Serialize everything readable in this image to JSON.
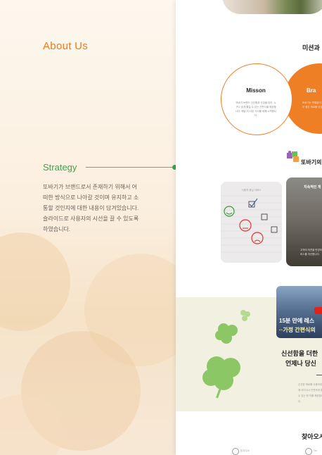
{
  "left": {
    "section_title": "About Us",
    "strategy_label": "Strategy",
    "description": "또바기가 브랜드로서 존재하기 위해서 어\n떠한 방식으로 나아갈 것이며 유지하고 소\n통할 것인지에 대한 내용이 담겨있습니다.\n슬라이드로 사용자의 시선을 끌 수 있도록\n하였습니다."
  },
  "right": {
    "mission_title": "미션과",
    "mission_circle": {
      "title": "Misson",
      "text": "또바기 브랜드 신선함과 건강을 담아, 누구나 쉽게 즐길 수 있는 간편식을 제공합니다. 매일 더 나은 식사를 위해 노력합니다."
    },
    "brand_circle": {
      "title": "Bra",
      "text": "또바기는 변함없이 한결같이 좋은 재료를 담습니다."
    },
    "strategy_title": "또바기의",
    "card1_label": "사용자 중심 서비스",
    "card2_title": "지속적인 개",
    "card2_sub": "고객의 의견을 반영하여 서비스를 개선합니다.",
    "video_line1": "15분 만에 레스",
    "video_line2": "··가정 간편식의",
    "fresh_line1": "신선함을 더한",
    "fresh_line2": "언제나 당신",
    "fresh_body": "신선한 재료를 사용하여 언제 어디서나 간편하게 즐길 수 있는 한 끼를 제공합니다.",
    "visit_title": "찾아오시",
    "contact_1": "본사주소",
    "contact_2": "Tel"
  }
}
